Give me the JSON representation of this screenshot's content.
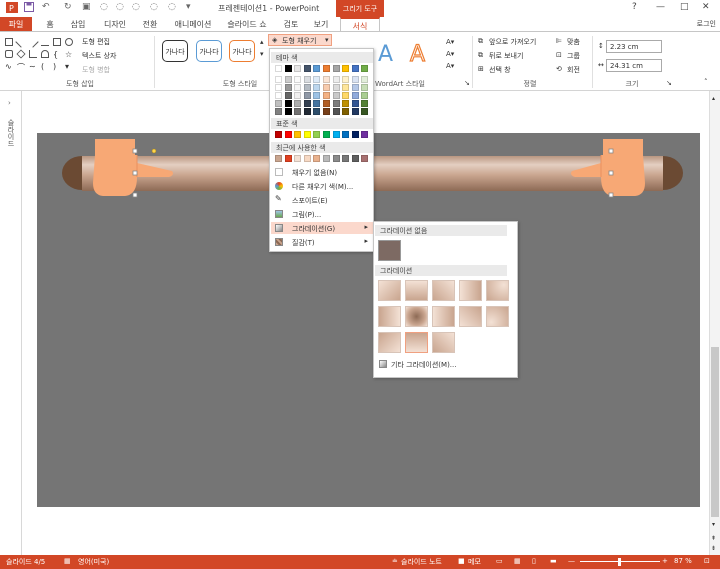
{
  "titlebar": {
    "title": "프레젠테이션1 - PowerPoint",
    "context_tools": "그리기 도구",
    "help": "?",
    "minimize": "—",
    "restore": "□",
    "close": "✕"
  },
  "tabs": {
    "file": "파일",
    "home": "홈",
    "insert": "삽입",
    "design": "디자인",
    "transitions": "전환",
    "animations": "애니메이션",
    "slideshow": "슬라이드 쇼",
    "review": "검토",
    "view": "보기",
    "format": "서식",
    "login": "로그인"
  },
  "ribbon": {
    "edit_shape": "도형 편집",
    "text_box": "텍스트 상자",
    "merge_shapes": "도형 병합",
    "insert_shapes_label": "도형 삽입",
    "shape_styles_label": "도형 스타일",
    "style_sample": "가나다",
    "shape_fill": "도형 채우기",
    "wordart_label": "WordArt 스타일",
    "wordart_a": "A",
    "bring_forward": "앞으로 가져오기",
    "send_backward": "뒤로 보내기",
    "selection_pane": "선택 창",
    "align": "맞춤",
    "group": "그룹",
    "rotate": "회전",
    "arrange_label": "정렬",
    "height_value": "2.23 cm",
    "width_value": "24.31 cm",
    "size_label": "크기"
  },
  "leftpane": {
    "slides_label": "슬라이드",
    "expand": "›"
  },
  "fillmenu": {
    "theme_colors": "테마 색",
    "standard_colors": "표준 색",
    "recent_colors": "최근에 사용한 색",
    "no_fill": "채우기 없음(N)",
    "more_colors": "다른 채우기 색(M)...",
    "eyedropper": "스포이트(E)",
    "picture": "그림(P)...",
    "gradient": "그라데이션(G)",
    "texture": "질감(T)",
    "submenu_arrow": "▸"
  },
  "gradmenu": {
    "no_gradient": "그라데이션 없음",
    "gradient": "그라데이션",
    "more_gradients": "기타 그라데이션(M)..."
  },
  "status": {
    "slide": "슬라이드 4/5",
    "language": "영어(미국)",
    "notes": "슬라이드 노트",
    "comments": "메모",
    "zoom": "87 %"
  },
  "colors": {
    "accent": "#d24726",
    "slide_bg": "#757575",
    "pipe": "#c9a58f",
    "pipe_end": "#6b4a33",
    "hand": "#f7a875",
    "theme_row1": [
      "#ffffff",
      "#000000",
      "#e7e6e6",
      "#44546a",
      "#5b9bd5",
      "#ed7d31",
      "#a5a5a5",
      "#ffc000",
      "#4472c4",
      "#70ad47"
    ],
    "standard": [
      "#c00000",
      "#ff0000",
      "#ffc000",
      "#ffff00",
      "#92d050",
      "#00b050",
      "#00b0f0",
      "#0070c0",
      "#002060",
      "#7030a0"
    ],
    "recent": [
      "#c9a58f",
      "#e04020",
      "#f3e1d5",
      "#f7d9c4",
      "#e9b18d",
      "#b9b9b9",
      "#8a8a8a",
      "#777777",
      "#5f5f5f",
      "#a77070"
    ]
  }
}
